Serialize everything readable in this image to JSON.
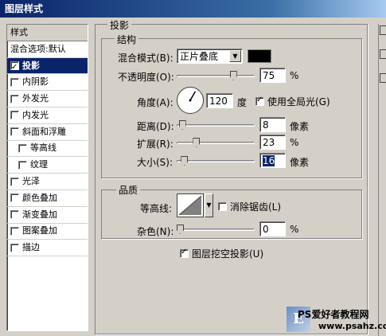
{
  "window": {
    "title": "图层样式"
  },
  "sidebar": {
    "header": "样式",
    "items": [
      {
        "label": "混合选项:默认",
        "checkbox": false,
        "checked": false,
        "sub": false,
        "selected": false
      },
      {
        "label": "投影",
        "checkbox": true,
        "checked": true,
        "sub": false,
        "selected": true
      },
      {
        "label": "内阴影",
        "checkbox": true,
        "checked": false,
        "sub": false,
        "selected": false
      },
      {
        "label": "外发光",
        "checkbox": true,
        "checked": false,
        "sub": false,
        "selected": false
      },
      {
        "label": "内发光",
        "checkbox": true,
        "checked": false,
        "sub": false,
        "selected": false
      },
      {
        "label": "斜面和浮雕",
        "checkbox": true,
        "checked": false,
        "sub": false,
        "selected": false
      },
      {
        "label": "等高线",
        "checkbox": true,
        "checked": false,
        "sub": true,
        "selected": false
      },
      {
        "label": "纹理",
        "checkbox": true,
        "checked": false,
        "sub": true,
        "selected": false
      },
      {
        "label": "光泽",
        "checkbox": true,
        "checked": false,
        "sub": false,
        "selected": false
      },
      {
        "label": "颜色叠加",
        "checkbox": true,
        "checked": false,
        "sub": false,
        "selected": false
      },
      {
        "label": "渐变叠加",
        "checkbox": true,
        "checked": false,
        "sub": false,
        "selected": false
      },
      {
        "label": "图案叠加",
        "checkbox": true,
        "checked": false,
        "sub": false,
        "selected": false
      },
      {
        "label": "描边",
        "checkbox": true,
        "checked": false,
        "sub": false,
        "selected": false
      }
    ]
  },
  "drop_shadow": {
    "title": "投影",
    "structure": {
      "title": "结构",
      "blend_mode": {
        "label": "混合模式(B):",
        "value": "正片叠底",
        "color": "#000000"
      },
      "opacity": {
        "label": "不透明度(O):",
        "value": "75",
        "unit": "%",
        "level": 0.75
      },
      "angle": {
        "label": "角度(A):",
        "value": "120",
        "unit": "度",
        "degrees": 120,
        "global_light_label": "使用全局光(G)",
        "global_light_checked": true
      },
      "distance": {
        "label": "距离(D):",
        "value": "8",
        "unit": "像素",
        "level": 0.03
      },
      "spread": {
        "label": "扩展(R):",
        "value": "23",
        "unit": "%",
        "level": 0.23
      },
      "size": {
        "label": "大小(S):",
        "value": "16",
        "unit": "像素",
        "level": 0.06
      }
    },
    "quality": {
      "title": "品质",
      "contour_label": "等高线:",
      "anti_alias_label": "消除锯齿(L)",
      "anti_alias_checked": false,
      "noise": {
        "label": "杂色(N):",
        "value": "0",
        "unit": "%",
        "level": 0.0
      }
    },
    "knockout": {
      "label": "图层挖空投影(U)",
      "checked": true
    }
  },
  "watermark": {
    "text1": "PS爱好者教程网",
    "text2": "www.psahz.com",
    "logo": "E"
  }
}
